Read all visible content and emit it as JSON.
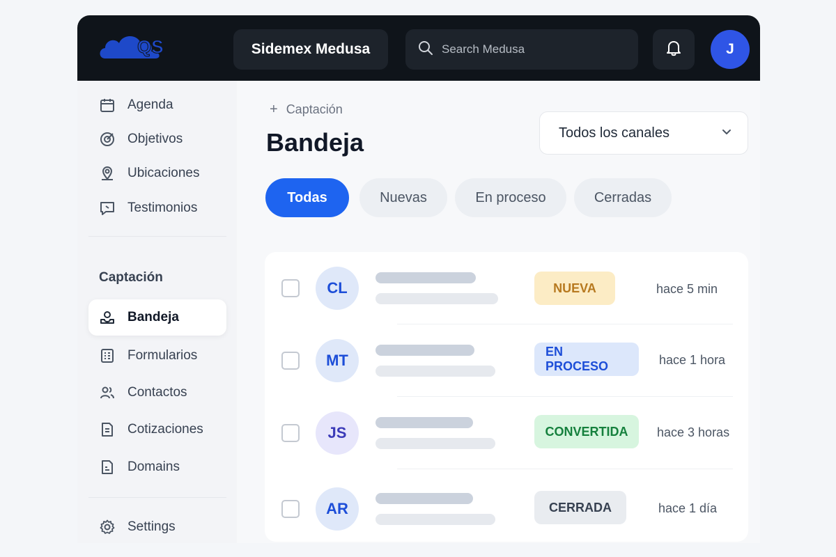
{
  "header": {
    "logo_text": "QS",
    "app_title": "Sidemex Medusa",
    "search_placeholder": "Search Medusa",
    "avatar_initial": "J"
  },
  "sidebar": {
    "items": [
      {
        "label": "Agenda",
        "icon": "calendar-icon"
      },
      {
        "label": "Objetivos",
        "icon": "target-icon"
      },
      {
        "label": "Ubicaciones",
        "icon": "map-pin-icon"
      },
      {
        "label": "Testimonios",
        "icon": "quote-icon"
      }
    ],
    "section_label": "Captación",
    "section_items": [
      {
        "label": "Bandeja",
        "icon": "inbox-icon",
        "active": true
      },
      {
        "label": "Formularios",
        "icon": "form-icon"
      },
      {
        "label": "Contactos",
        "icon": "users-icon"
      },
      {
        "label": "Cotizaciones",
        "icon": "document-icon"
      },
      {
        "label": "Domains",
        "icon": "file-icon"
      }
    ],
    "settings_label": "Settings"
  },
  "main": {
    "breadcrumb": "Captación",
    "title": "Bandeja",
    "channel_select": "Todos los canales",
    "tabs": [
      {
        "label": "Todas",
        "active": true
      },
      {
        "label": "Nuevas"
      },
      {
        "label": "En proceso"
      },
      {
        "label": "Cerradas"
      }
    ],
    "rows": [
      {
        "initials": "CL",
        "status": "NUEVA",
        "time": "hace 5 min"
      },
      {
        "initials": "MT",
        "status": "EN PROCESO",
        "time": "hace 1 hora"
      },
      {
        "initials": "JS",
        "status": "CONVERTIDA",
        "time": "hace 3 horas"
      },
      {
        "initials": "AR",
        "status": "CERRADA",
        "time": "hace 1 día"
      }
    ]
  },
  "colors": {
    "accent": "#1e64f0",
    "topbar": "#0f141a",
    "nueva_bg": "#fcecc5",
    "nueva_fg": "#b7791f",
    "proceso_bg": "#dce7fb",
    "proceso_fg": "#1d4ed8",
    "convertida_bg": "#d7f5df",
    "convertida_fg": "#15803d",
    "cerrada_bg": "#e9ecf0",
    "cerrada_fg": "#374151"
  }
}
